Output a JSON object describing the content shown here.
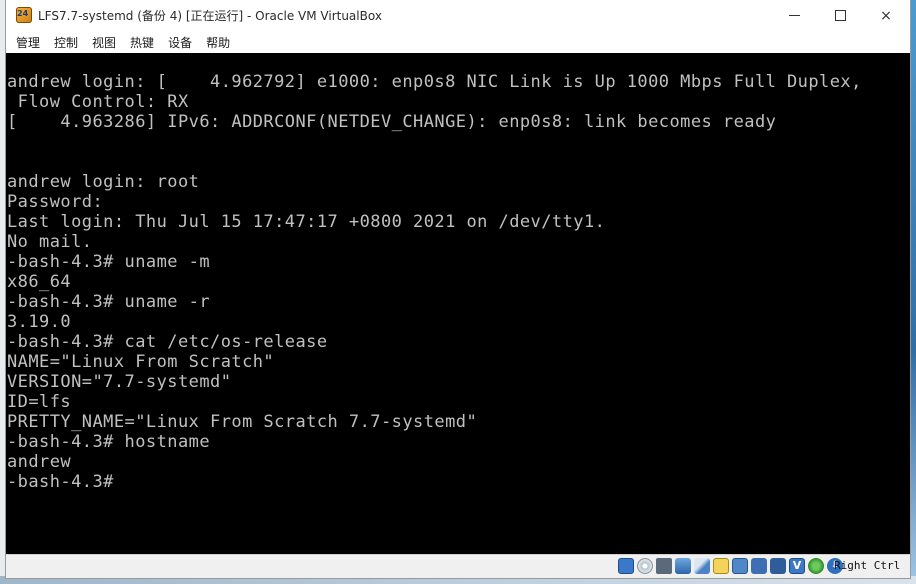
{
  "window": {
    "title": "LFS7.7-systemd (备份 4) [正在运行] - Oracle VM VirtualBox",
    "controls": {
      "minimize": "minimize",
      "maximize": "maximize",
      "close": "×"
    }
  },
  "menu": {
    "items": [
      "管理",
      "控制",
      "视图",
      "热键",
      "设备",
      "帮助"
    ]
  },
  "console": {
    "lines": [
      "andrew login: [    4.962792] e1000: enp0s8 NIC Link is Up 1000 Mbps Full Duplex,",
      " Flow Control: RX",
      "[    4.963286] IPv6: ADDRCONF(NETDEV_CHANGE): enp0s8: link becomes ready",
      "",
      "",
      "andrew login: root",
      "Password:",
      "Last login: Thu Jul 15 17:47:17 +0800 2021 on /dev/tty1.",
      "No mail.",
      "-bash-4.3# uname -m",
      "x86_64",
      "-bash-4.3# uname -r",
      "3.19.0",
      "-bash-4.3# cat /etc/os-release",
      "NAME=\"Linux From Scratch\"",
      "VERSION=\"7.7-systemd\"",
      "ID=lfs",
      "PRETTY_NAME=\"Linux From Scratch 7.7-systemd\"",
      "-bash-4.3# hostname",
      "andrew",
      "-bash-4.3#"
    ]
  },
  "statusbar": {
    "icons": [
      "hard-disk-icon",
      "optical-drive-icon",
      "audio-icon",
      "network-icon",
      "usb-icon",
      "shared-folders-icon",
      "display-icon",
      "recording-icon",
      "cpu-icon",
      "vt-x-icon",
      "mouse-integration-icon",
      "keyboard-capture-icon"
    ],
    "vt_label": "V",
    "host_key": "Right Ctrl"
  }
}
